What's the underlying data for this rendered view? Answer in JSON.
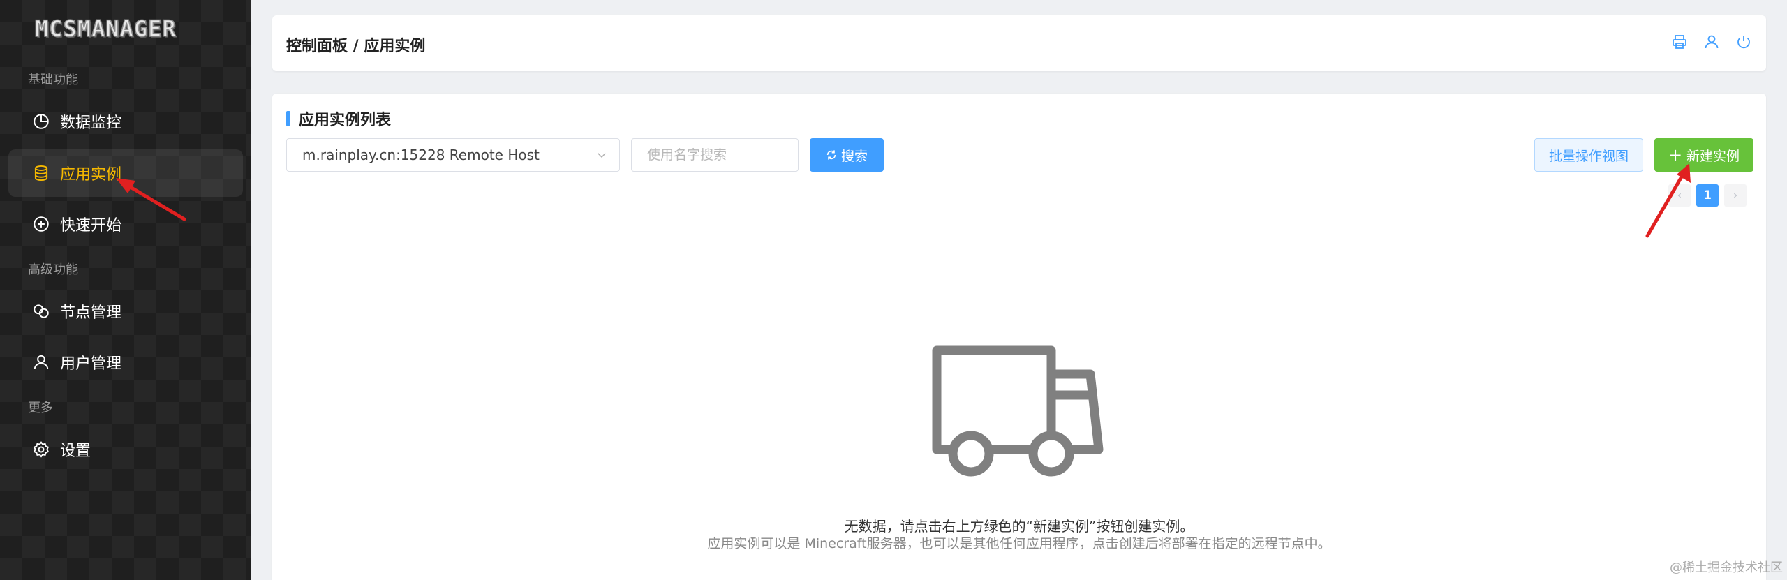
{
  "sidebar": {
    "logo": "MCSMANAGER",
    "sections": [
      {
        "title": "基础功能",
        "items": [
          {
            "label": "数据监控",
            "icon": "pie-chart-icon",
            "active": false
          },
          {
            "label": "应用实例",
            "icon": "database-icon",
            "active": true
          },
          {
            "label": "快速开始",
            "icon": "plus-circle-icon",
            "active": false
          }
        ]
      },
      {
        "title": "高级功能",
        "items": [
          {
            "label": "节点管理",
            "icon": "nodes-icon",
            "active": false
          },
          {
            "label": "用户管理",
            "icon": "user-icon",
            "active": false
          }
        ]
      },
      {
        "title": "更多",
        "items": [
          {
            "label": "设置",
            "icon": "gear-icon",
            "active": false
          }
        ]
      }
    ]
  },
  "header": {
    "breadcrumb": "控制面板 / 应用实例",
    "icons": [
      "printer-icon",
      "user-icon",
      "power-icon"
    ]
  },
  "main": {
    "title": "应用实例列表",
    "node_select": {
      "value": "m.rainplay.cn:15228 Remote Host"
    },
    "search": {
      "placeholder": "使用名字搜索",
      "value": "",
      "button_label": "搜索"
    },
    "batch_button_label": "批量操作视图",
    "new_button_label": "新建实例",
    "pagination": {
      "current": "1"
    },
    "empty": {
      "icon": "truck-icon",
      "message": "无数据，请点击右上方绿色的“新建实例”按钮创建实例。",
      "hint": "应用实例可以是 Minecraft服务器，也可以是其他任何应用程序，点击创建后将部署在指定的远程节点中。"
    }
  },
  "watermark": "@稀土掘金技术社区",
  "colors": {
    "accent": "#409eff",
    "success": "#67c23a",
    "active_nav": "#f5b800",
    "annotation": "#e02020"
  }
}
